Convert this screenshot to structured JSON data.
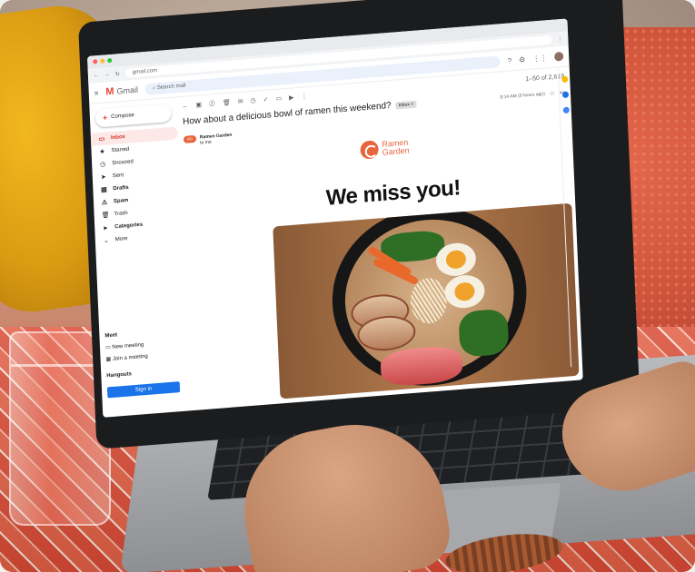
{
  "browser": {
    "url": "gmail.com"
  },
  "gmail": {
    "logo_text": "Gmail",
    "search_placeholder": "Search mail",
    "pagination": "1–50 of 2,619",
    "compose_label": "Compose",
    "nav": [
      {
        "label": "Inbox",
        "icon": "inbox-icon",
        "active": true
      },
      {
        "label": "Starred",
        "icon": "star-icon"
      },
      {
        "label": "Snoozed",
        "icon": "clock-icon"
      },
      {
        "label": "Sent",
        "icon": "send-icon"
      },
      {
        "label": "Drafts",
        "icon": "draft-icon"
      },
      {
        "label": "Spam",
        "icon": "spam-icon"
      },
      {
        "label": "Trash",
        "icon": "trash-icon"
      },
      {
        "label": "Categories",
        "icon": "label-icon"
      },
      {
        "label": "More",
        "icon": "chevron-down-icon"
      }
    ],
    "meet": {
      "heading": "Meet",
      "new_meeting": "New meeting",
      "join_meeting": "Join a meeting"
    },
    "hangouts": {
      "heading": "Hangouts",
      "sign_in": "Sign in"
    }
  },
  "email": {
    "subject": "How about a delicious bowl of ramen this weekend?",
    "inbox_tag": "Inbox ×",
    "sender_name": "Ramen Garden",
    "to_line": "to me",
    "time": "9:14 AM (0 hours ago)",
    "brand_line1": "Ramen",
    "brand_line2": "Garden",
    "headline": "We miss you!"
  },
  "colors": {
    "brand": "#e8643d",
    "gmail_red": "#ea4335",
    "signin_blue": "#1a73e8"
  }
}
